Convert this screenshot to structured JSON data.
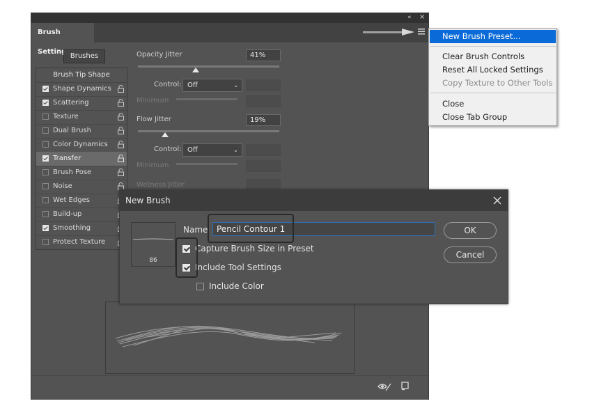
{
  "panel": {
    "tab_title": "Brush Settings",
    "brushes_button": "Brushes",
    "list": [
      {
        "label": "Brush Tip Shape",
        "header": true
      },
      {
        "label": "Shape Dynamics",
        "checked": true,
        "selected": false
      },
      {
        "label": "Scattering",
        "checked": true,
        "selected": false
      },
      {
        "label": "Texture",
        "checked": false,
        "selected": false
      },
      {
        "label": "Dual Brush",
        "checked": false,
        "selected": false
      },
      {
        "label": "Color Dynamics",
        "checked": false,
        "selected": false
      },
      {
        "label": "Transfer",
        "checked": true,
        "selected": true
      },
      {
        "label": "Brush Pose",
        "checked": false,
        "selected": false
      },
      {
        "label": "Noise",
        "checked": false,
        "selected": false
      },
      {
        "label": "Wet Edges",
        "checked": false,
        "selected": false
      },
      {
        "label": "Build-up",
        "checked": false,
        "selected": false
      },
      {
        "label": "Smoothing",
        "checked": true,
        "selected": false
      },
      {
        "label": "Protect Texture",
        "checked": false,
        "selected": false
      }
    ],
    "opacity_jitter": {
      "label": "Opacity Jitter",
      "value": "41%",
      "level": 0.41
    },
    "control1": {
      "label": "Control:",
      "value": "Off"
    },
    "minimum1": {
      "label": "Minimum"
    },
    "flow_jitter": {
      "label": "Flow Jitter",
      "value": "19%",
      "level": 0.19
    },
    "control2": {
      "label": "Control:",
      "value": "Off"
    },
    "minimum2": {
      "label": "Minimum"
    },
    "wetness_jitter": {
      "label": "Wetness Jitter"
    }
  },
  "menu": {
    "items": [
      {
        "label": "New Brush Preset...",
        "highlighted": true
      },
      {
        "label": "Clear Brush Controls"
      },
      {
        "label": "Reset All Locked Settings"
      },
      {
        "label": "Copy Texture to Other Tools",
        "disabled": true
      },
      {
        "label": "Close"
      },
      {
        "label": "Close Tab Group"
      }
    ]
  },
  "dialog": {
    "title": "New Brush",
    "name_label": "Name",
    "name_value": "Pencil Contour 1",
    "brush_size": "86",
    "capture_size_label": "Capture Brush Size in Preset",
    "include_tool_label": "Include Tool Settings",
    "include_color_label": "Include Color",
    "ok_label": "OK",
    "cancel_label": "Cancel"
  },
  "icons": {
    "lock": "lock-icon",
    "panel_menu": "hamburger-menu-icon",
    "close": "close-icon",
    "eye": "eye-icon",
    "new_preset": "new-preset-icon",
    "collapse": "collapse-arrows-icon"
  },
  "colors": {
    "panel_bg": "#535353",
    "menu_highlight": "#0a6ad8",
    "dialog_title_bg": "#3c3c3c"
  }
}
